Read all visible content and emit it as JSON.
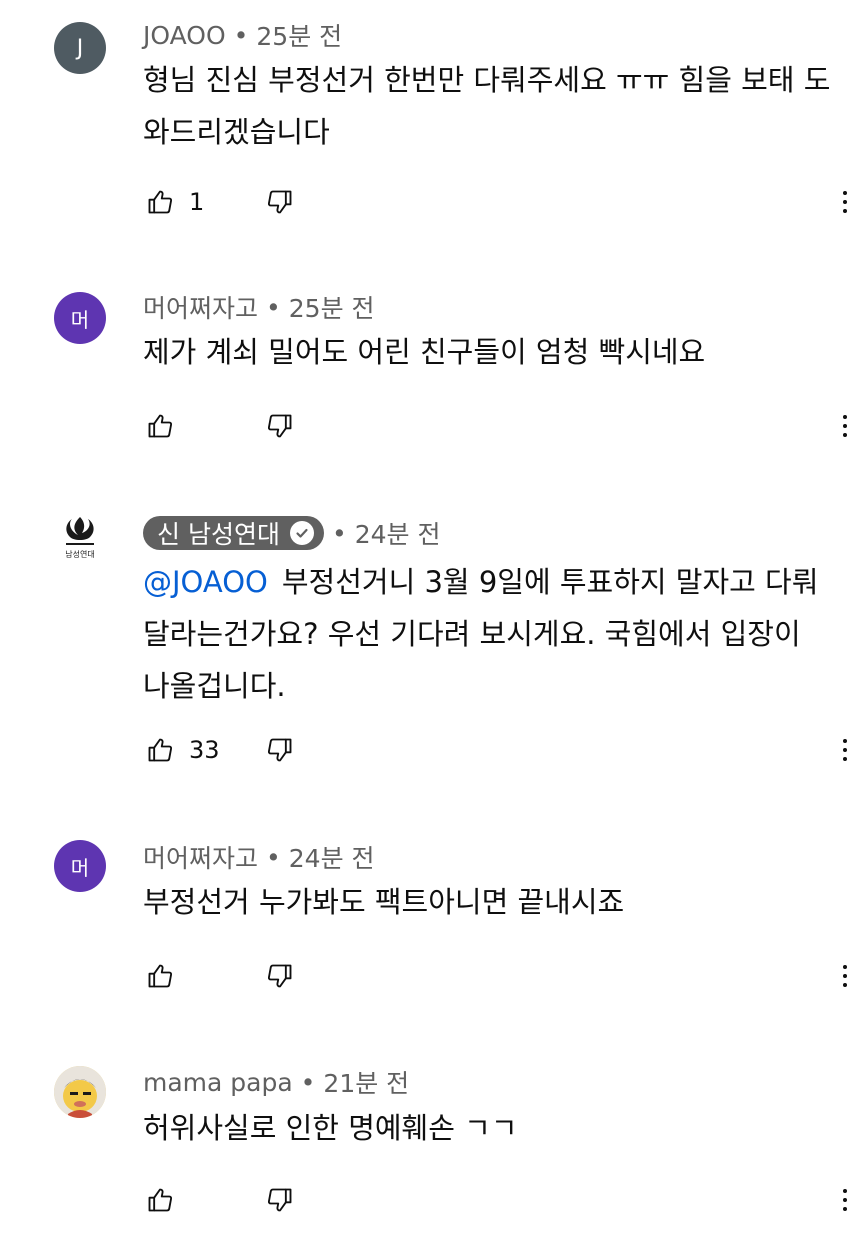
{
  "comments": [
    {
      "avatar_letter": "J",
      "avatar_color": "#4f5b62",
      "author": "JOAOO",
      "time": "25분 전",
      "text": "형님 진심 부정선거 한번만 다뤄주세요 ㅠㅠ 힘을 보태 도와드리겠습니다",
      "likes": "1"
    },
    {
      "avatar_letter": "머",
      "avatar_color": "#5e35b1",
      "author": "머어쩌자고",
      "time": "25분 전",
      "text": "제가 계쇠 밀어도 어린 친구들이 엄청 빡시네요",
      "likes": ""
    },
    {
      "avatar_letter": "",
      "avatar_color": "#ffffff",
      "avatar_logo_text": "남성연대",
      "author": "신 남성연대",
      "verified": true,
      "time": "24분 전",
      "mention": "@JOAOO",
      "text": "부정선거니 3월 9일에 투표하지 말자고 다뤄달라는건가요? 우선 기다려 보시게요. 국힘에서 입장이 나올겁니다.",
      "likes": "33"
    },
    {
      "avatar_letter": "머",
      "avatar_color": "#5e35b1",
      "author": "머어쩌자고",
      "time": "24분 전",
      "text": "부정선거 누가봐도 팩트아니면 끝내시죠",
      "likes": ""
    },
    {
      "avatar_letter": "",
      "avatar_color": "#f3c948",
      "author": "mama papa",
      "time": "21분 전",
      "text": "허위사실로 인한 명예훼손 ㄱㄱ",
      "likes": ""
    }
  ]
}
